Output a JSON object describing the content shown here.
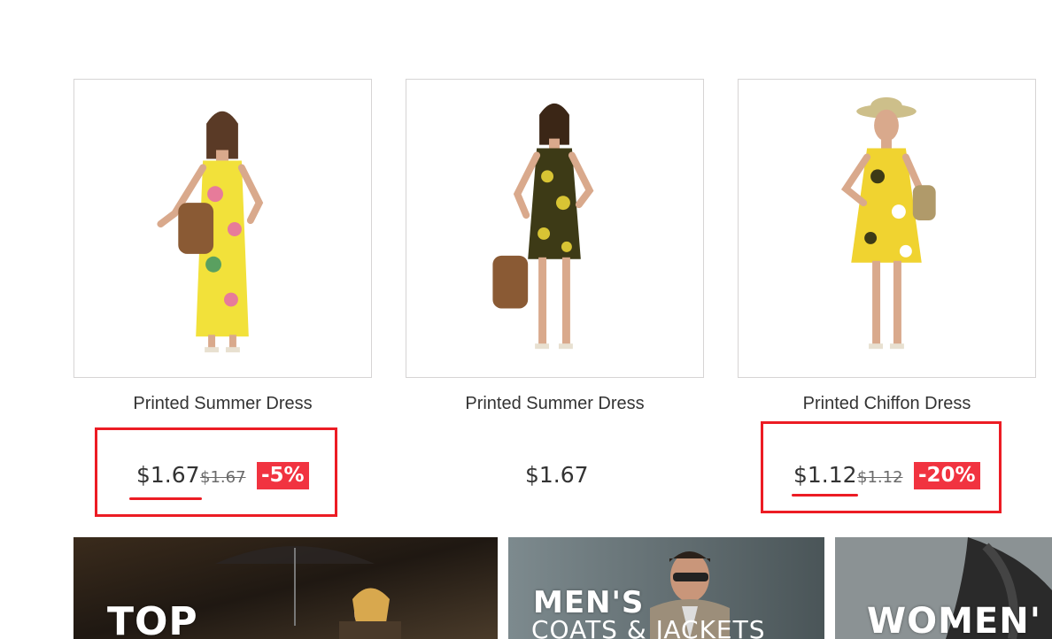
{
  "products": [
    {
      "name": "Printed Summer Dress",
      "price": "$1.67",
      "old_price": "$1.67",
      "discount": "-5%",
      "dress_color": "#f2e13a",
      "image_icon": "woman-yellow-floral-long-dress"
    },
    {
      "name": "Printed Summer Dress",
      "price": "$1.67",
      "old_price": "",
      "discount": "",
      "dress_color": "#3d3a16",
      "image_icon": "woman-dark-floral-short-dress"
    },
    {
      "name": "Printed Chiffon Dress",
      "price": "$1.12",
      "old_price": "$1.12",
      "discount": "-20%",
      "dress_color": "#f0d330",
      "image_icon": "woman-yellow-chiffon-dress-hat"
    }
  ],
  "banners": [
    {
      "title": "TOP",
      "subtitle": "",
      "image_icon": "woman-umbrella-rain-photo"
    },
    {
      "title": "MEN'S",
      "subtitle": "COATS & JACKETS",
      "image_icon": "man-sunglasses-photo"
    },
    {
      "title": "WOMEN'",
      "subtitle": "",
      "image_icon": "woman-portrait-photo"
    }
  ],
  "colors": {
    "highlight": "#ec1c24",
    "discount_bg": "#f13340",
    "card_border": "#d6d4d4"
  }
}
